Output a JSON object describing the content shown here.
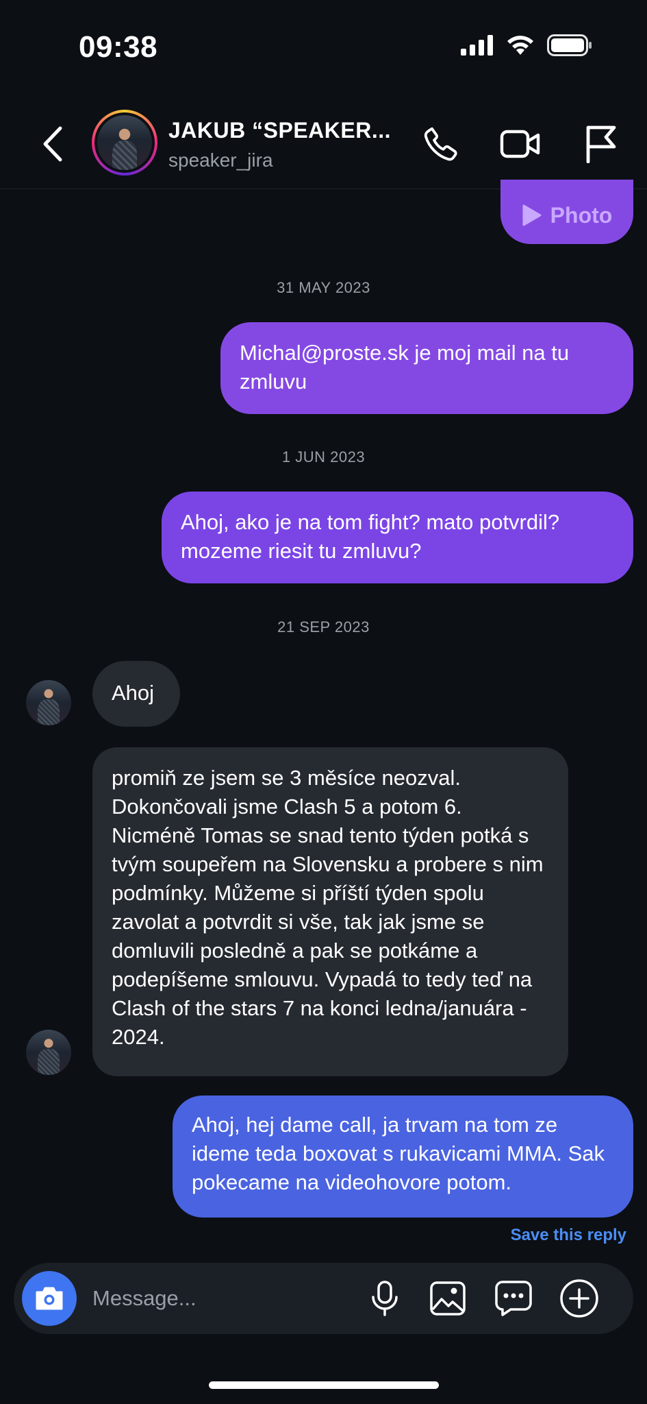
{
  "status_bar": {
    "time": "09:38"
  },
  "header": {
    "contact_name": "JAKUB “SPEAKER...",
    "username": "speaker_jira"
  },
  "messages": [
    {
      "type": "outgoing",
      "text": "Photo",
      "kind": "photo"
    },
    {
      "type": "date",
      "text": "31 MAY 2023"
    },
    {
      "type": "outgoing",
      "text": "Michal@proste.sk je moj mail na tu zmluvu"
    },
    {
      "type": "date",
      "text": "1 JUN 2023"
    },
    {
      "type": "outgoing",
      "text": "Ahoj, ako je na tom fight? mato potvrdil? mozeme riesit tu zmluvu?"
    },
    {
      "type": "date",
      "text": "21 SEP 2023"
    },
    {
      "type": "incoming",
      "text": "Ahoj"
    },
    {
      "type": "incoming",
      "text": "promiň ze jsem se 3 měsíce neozval. Dokončovali jsme Clash 5 a potom 6. Nicméně Tomas se snad tento týden potká s tvým soupeřem na Slovensku a probere s nim podmínky. Můžeme si příští týden spolu zavolat a potvrdit si vše, tak jak jsme se domluvili posledně a pak se potkáme a podepíšeme smlouvu. Vypadá to tedy teď na Clash of the stars 7 na konci ledna/januára - 2024."
    },
    {
      "type": "outgoing",
      "text": "Ahoj, hej dame call, ja trvam na tom ze ideme teda boxovat s rukavicami MMA. Sak pokecame na videohovore potom."
    }
  ],
  "save_reply_label": "Save this reply",
  "composer": {
    "placeholder": "Message..."
  },
  "colors": {
    "background": "#0c0f14",
    "outgoing_purple": "#8549e3",
    "outgoing_blue": "#4a63e0",
    "incoming": "#262a31",
    "camera_button": "#3f75f0",
    "link": "#4b8ef5"
  },
  "icons": [
    "signal-icon",
    "wifi-icon",
    "battery-icon",
    "back-icon",
    "phone-icon",
    "video-icon",
    "flag-icon",
    "play-icon",
    "camera-icon",
    "microphone-icon",
    "gallery-icon",
    "sticker-icon",
    "plus-icon"
  ]
}
